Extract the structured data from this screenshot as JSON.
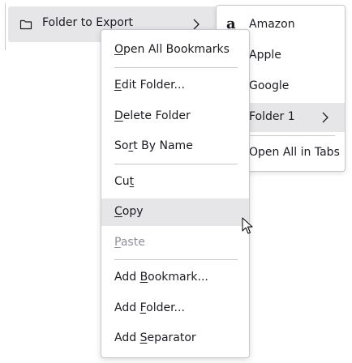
{
  "parent_menu": {
    "folder_label": "Folder to Export",
    "folder_icon": "folder-icon",
    "chevron_icon": "chevron-right-icon"
  },
  "submenu": {
    "items": [
      {
        "label": "Amazon",
        "favicon": "a",
        "icon": "amazon-favicon-icon"
      },
      {
        "label": "Apple",
        "icon": "apple-favicon-icon"
      },
      {
        "label": "Google",
        "icon": "google-favicon-icon"
      },
      {
        "label": "Folder 1",
        "icon": "folder-icon",
        "has_submenu": true
      },
      {
        "label": "Open All in Tabs"
      }
    ]
  },
  "context_menu": {
    "items": [
      {
        "pre": "",
        "key": "O",
        "post": "pen All Bookmarks"
      },
      {
        "pre": "",
        "key": "E",
        "post": "dit Folder..."
      },
      {
        "pre": "",
        "key": "D",
        "post": "elete Folder"
      },
      {
        "pre": "So",
        "key": "r",
        "post": "t By Name"
      },
      {
        "pre": "Cu",
        "key": "t",
        "post": ""
      },
      {
        "pre": "",
        "key": "C",
        "post": "opy"
      },
      {
        "pre": "",
        "key": "P",
        "post": "aste"
      },
      {
        "pre": "Add ",
        "key": "B",
        "post": "ookmark..."
      },
      {
        "pre": "Add ",
        "key": "F",
        "post": "older..."
      },
      {
        "pre": "Add ",
        "key": "S",
        "post": "eparator"
      }
    ],
    "hovered_item": "Copy",
    "disabled_item": "Paste"
  },
  "colors": {
    "highlight": "#e6e6e8",
    "border": "#c8c8cc",
    "text": "#1c1b22",
    "disabled_text": "#8f8f9d"
  }
}
